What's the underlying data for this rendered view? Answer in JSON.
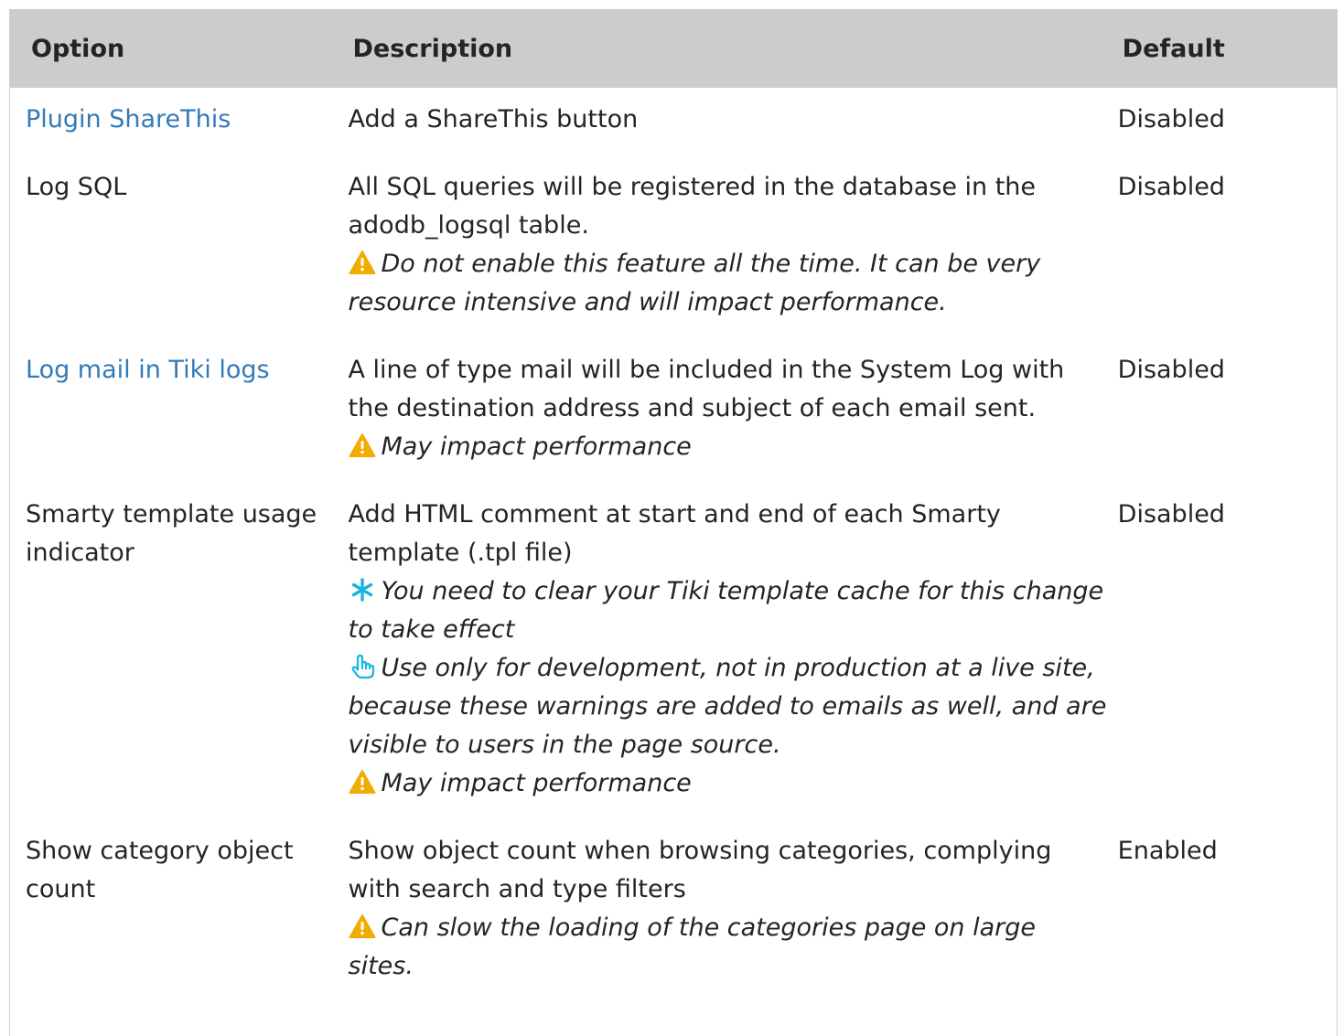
{
  "table": {
    "headers": {
      "option": "Option",
      "description": "Description",
      "default": "Default"
    },
    "rows": [
      {
        "option": "Plugin ShareThis",
        "option_is_link": true,
        "description": "Add a ShareThis button",
        "notes": [],
        "default": "Disabled"
      },
      {
        "option": "Log SQL",
        "option_is_link": false,
        "description": "All SQL queries will be registered in the database in the adodb_logsql table.",
        "notes": [
          {
            "icon": "warning-icon",
            "text": "Do not enable this feature all the time. It can be very resource intensive and will impact performance."
          }
        ],
        "default": "Disabled"
      },
      {
        "option": "Log mail in Tiki logs",
        "option_is_link": true,
        "description": "A line of type mail will be included in the System Log with the destination address and subject of each email sent.",
        "notes": [
          {
            "icon": "warning-icon",
            "text": "May impact performance"
          }
        ],
        "default": "Disabled"
      },
      {
        "option": "Smarty template usage indicator",
        "option_is_link": false,
        "description": "Add HTML comment at start and end of each Smarty template (.tpl file)",
        "notes": [
          {
            "icon": "asterisk-icon",
            "text": "You need to clear your Tiki template cache for this change to take effect"
          },
          {
            "icon": "hand-pointer-icon",
            "text": "Use only for development, not in production at a live site, because these warnings are added to emails as well, and are visible to users in the page source."
          },
          {
            "icon": "warning-icon",
            "text": "May impact performance"
          }
        ],
        "default": "Disabled"
      },
      {
        "option": "Show category object count",
        "option_is_link": false,
        "description": "Show object count when browsing categories, complying with search and type filters",
        "notes": [
          {
            "icon": "warning-icon",
            "text": "Can slow the loading of the categories page on large sites."
          }
        ],
        "default": "Enabled"
      }
    ]
  },
  "colors": {
    "header_bg": "#cccccc",
    "link": "#337ab7",
    "warning": "#f0ad00",
    "info": "#17b4e0"
  }
}
